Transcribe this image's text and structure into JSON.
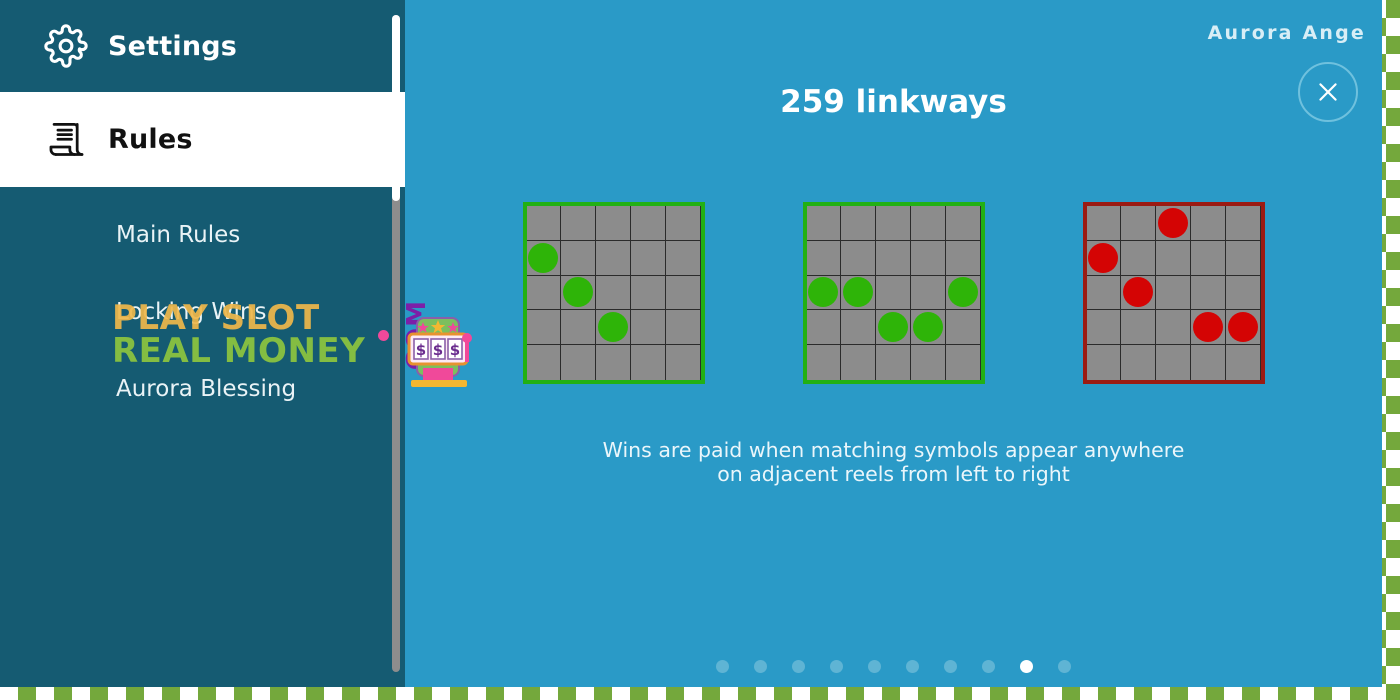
{
  "theme": {
    "checker_green": "#74a83c",
    "checker_white": "#ffffff",
    "sidebar_bg": "#155b72",
    "content_bg": "#2a9ac7",
    "active_nav_bg": "#ffffff",
    "green_symbol": "#2eb408",
    "red_symbol": "#d40404",
    "grid_cell": "#8c8c8c",
    "grid_line": "#2b2b2b"
  },
  "sidebar": {
    "nav": [
      {
        "label": "Settings",
        "icon": "gear-icon",
        "active": false
      },
      {
        "label": "Rules",
        "icon": "scroll-icon",
        "active": true
      }
    ],
    "sub_items": [
      {
        "label": "Main Rules"
      },
      {
        "label": "Locking Wins"
      },
      {
        "label": "Aurora Blessing"
      }
    ],
    "scrollbar": {
      "visible": true
    }
  },
  "content": {
    "game_title": "Aurora Ange",
    "heading": "259 linkways",
    "close_label": "close-icon",
    "caption_line1": "Wins are paid when matching symbols appear anywhere",
    "caption_line2": "on adjacent reels from left to right",
    "grids": [
      {
        "name": "linkway-example-1",
        "color": "green",
        "rows": 5,
        "cols": 5,
        "hits": [
          [
            1,
            0
          ],
          [
            2,
            1
          ],
          [
            3,
            2
          ]
        ]
      },
      {
        "name": "linkway-example-2",
        "color": "green",
        "rows": 5,
        "cols": 5,
        "hits": [
          [
            2,
            0
          ],
          [
            2,
            1
          ],
          [
            2,
            4
          ],
          [
            3,
            2
          ],
          [
            3,
            3
          ]
        ]
      },
      {
        "name": "linkway-example-3",
        "color": "red",
        "rows": 5,
        "cols": 5,
        "hits": [
          [
            0,
            2
          ],
          [
            1,
            0
          ],
          [
            2,
            1
          ],
          [
            3,
            3
          ],
          [
            3,
            4
          ]
        ]
      }
    ],
    "pager": {
      "total": 10,
      "active_index": 8
    }
  },
  "watermark": {
    "line1": "PLAY SLOT",
    "line2": "REAL MONEY",
    "suffix": "COM",
    "dot_color": "#f0499a",
    "icon": "slot-machine-icon"
  }
}
